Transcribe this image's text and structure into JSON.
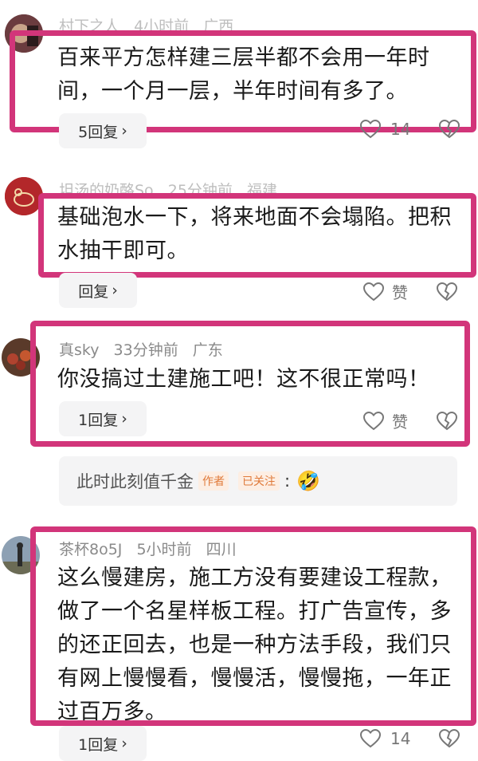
{
  "comments": [
    {
      "author": "村下之人",
      "time": "4小时前",
      "region": "广西",
      "text": "百来平方怎样建三层半都不会用一年时间，一个月一层，半年时间有多了。",
      "reply_label": "5回复",
      "likes": "14"
    },
    {
      "author": "坦汤的奶酪So",
      "time": "25分钟前",
      "region": "福建",
      "text": "基础泡水一下，将来地面不会塌陷。把积水抽干即可。",
      "reply_label": "回复",
      "likes": "赞"
    },
    {
      "author": "真sky",
      "time": "33分钟前",
      "region": "广东",
      "text": "你没搞过土建施工吧！这不很正常吗！",
      "reply_label": "1回复",
      "likes": "赞",
      "sub_reply": {
        "text": "此时此刻值千金",
        "author_tag": "作者",
        "follow_tag": "已关注",
        "suffix": ":",
        "emoji": "🤣"
      }
    },
    {
      "author": "茶杯8o5J",
      "time": "5小时前",
      "region": "四川",
      "text": "这么慢建房，施工方没有要建设工程款，做了一个名星样板工程。打广告宣传，多的还正回去，也是一种方法手段，我们只有网上慢慢看，慢慢活，慢慢拖，一年正过百万多。",
      "reply_label": "1回复",
      "likes": "14"
    }
  ],
  "colors": {
    "highlight": "#d2357a",
    "pill_bg": "#f4f4f5",
    "meta": "#8a8a8a",
    "tag": "#e07a3a"
  },
  "icons": [
    "heart-icon",
    "broken-heart-icon",
    "chevron-right-icon"
  ]
}
